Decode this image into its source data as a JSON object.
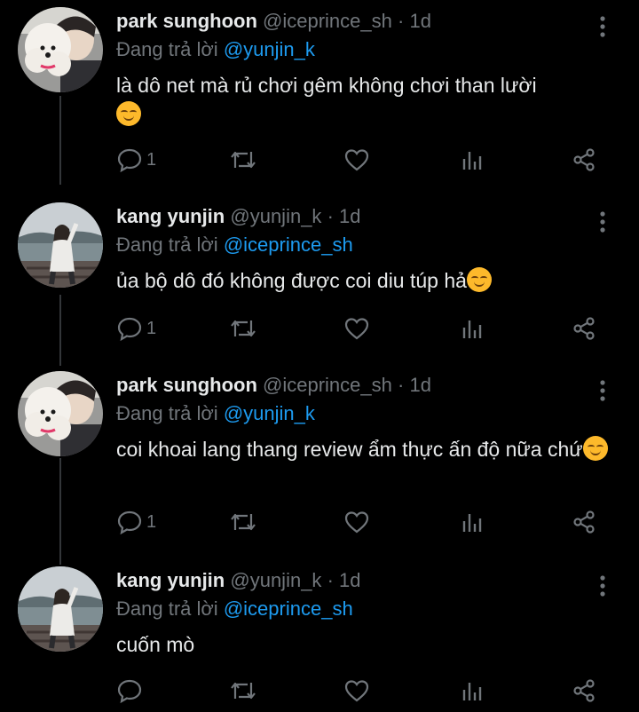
{
  "colors": {
    "background": "#000000",
    "text": "#e7e9ea",
    "secondary": "#71767b",
    "link": "#1d9bf0"
  },
  "tweets": [
    {
      "name": "park sunghoon",
      "handle": "@iceprince_sh",
      "separator": "·",
      "time": "1d",
      "reply_prefix": "Đang trả lời",
      "reply_to": "@yunjin_k",
      "text": "là dô net mà rủ chơi gêm không chơi than lười",
      "emoji": "relieved-face",
      "reply_count": "1",
      "avatar": "dog-and-boy-avatar"
    },
    {
      "name": "kang yunjin",
      "handle": "@yunjin_k",
      "separator": "·",
      "time": "1d",
      "reply_prefix": "Đang trả lời",
      "reply_to": "@iceprince_sh",
      "text": "ủa bộ dô đó không được coi diu túp hả",
      "emoji": "relieved-face",
      "reply_count": "1",
      "avatar": "girl-by-sea-avatar"
    },
    {
      "name": "park sunghoon",
      "handle": "@iceprince_sh",
      "separator": "·",
      "time": "1d",
      "reply_prefix": "Đang trả lời",
      "reply_to": "@yunjin_k",
      "text": "coi khoai lang thang review ẩm thực ấn độ nữa chứ",
      "emoji": "relieved-face",
      "reply_count": "1",
      "avatar": "dog-and-boy-avatar"
    },
    {
      "name": "kang yunjin",
      "handle": "@yunjin_k",
      "separator": "·",
      "time": "1d",
      "reply_prefix": "Đang trả lời",
      "reply_to": "@iceprince_sh",
      "text": "cuốn mò",
      "emoji": "",
      "reply_count": "",
      "avatar": "girl-by-sea-avatar"
    }
  ],
  "icons": {
    "reply": "reply-bubble-icon",
    "retweet": "retweet-icon",
    "like": "heart-icon",
    "views": "analytics-icon",
    "share": "share-icon",
    "more": "more-vertical-icon"
  }
}
